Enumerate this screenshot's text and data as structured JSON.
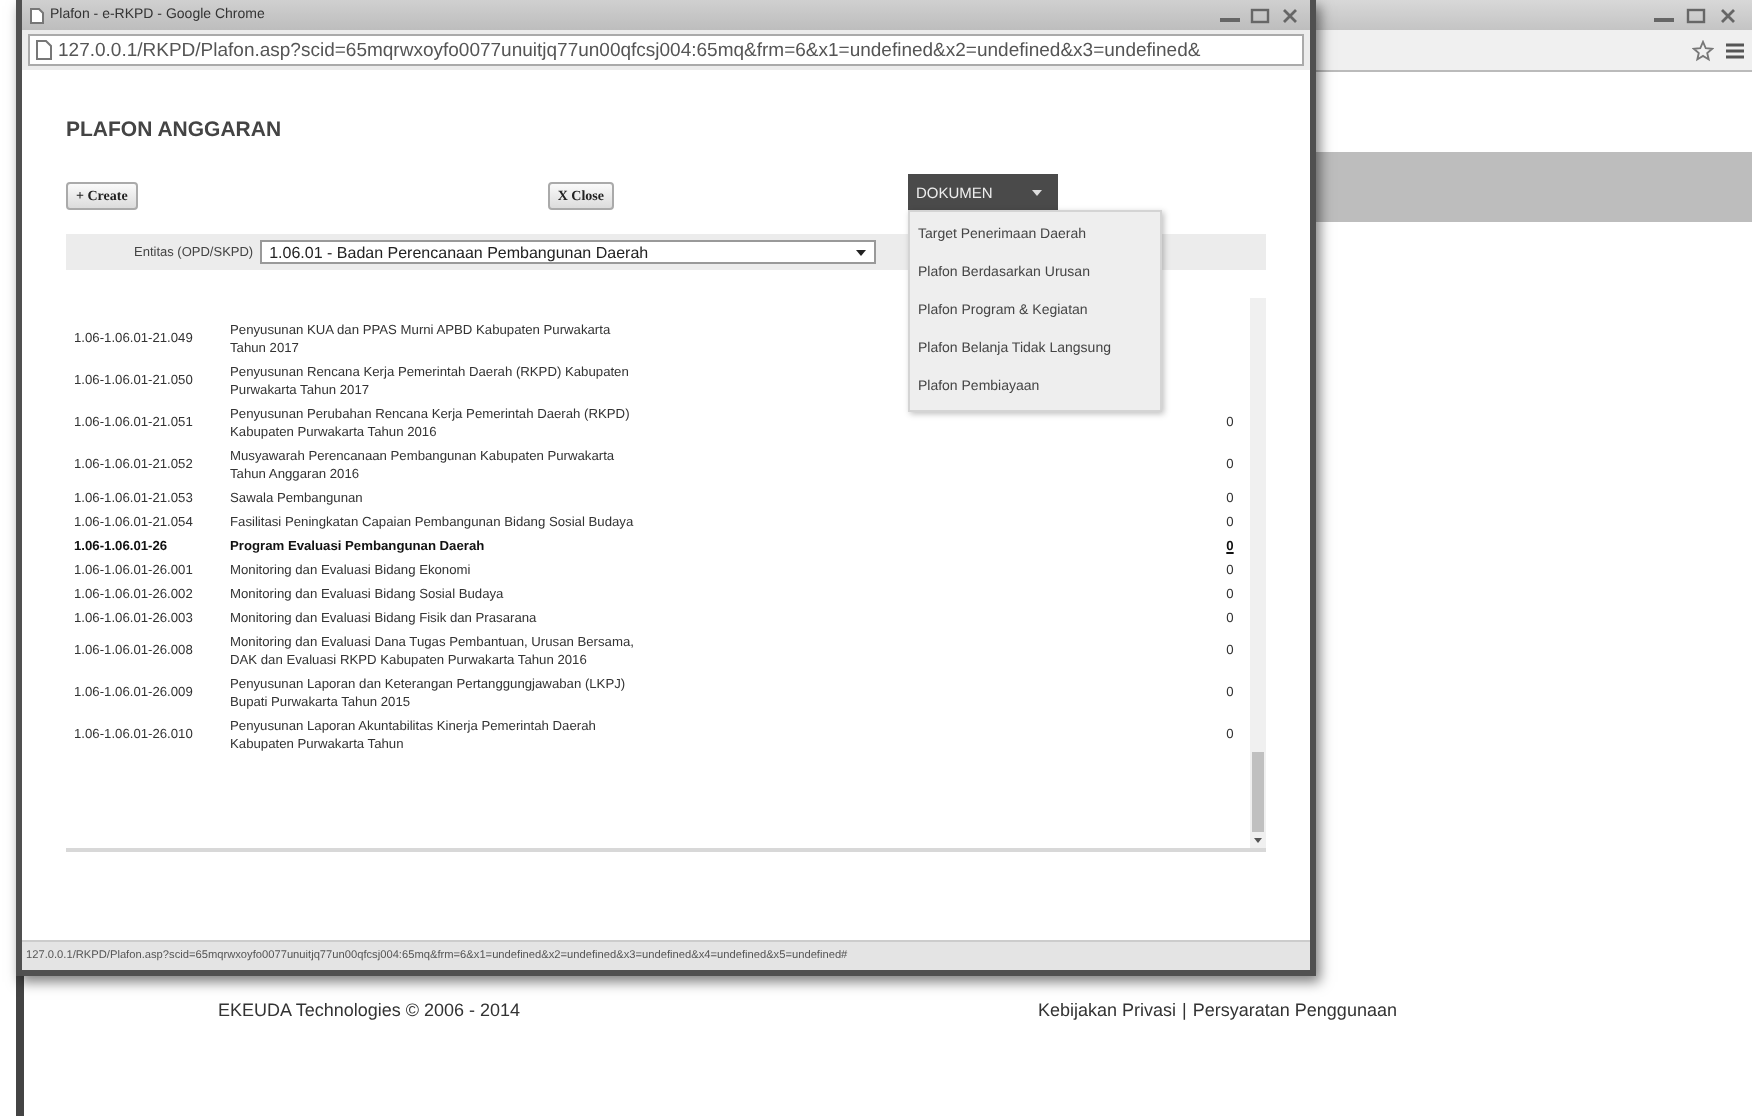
{
  "background_window": {
    "footer": {
      "copyright": "EKEUDA Technologies © 2006 - 2014",
      "links": [
        "Kebijakan Privasi",
        "Persyaratan Penggunaan"
      ],
      "separator": "|"
    }
  },
  "popup": {
    "title": "Plafon - e-RKPD - Google Chrome",
    "url": "127.0.0.1/RKPD/Plafon.asp?scid=65mqrwxoyfo0077unuitjq77un00qfcsj004:65mq&frm=6&x1=undefined&x2=undefined&x3=undefined&",
    "heading": "PLAFON ANGGARAN",
    "create_button": "+ Create",
    "close_button": "X Close",
    "dokumen": {
      "label": "DOKUMEN",
      "expanded": true,
      "items": [
        "Target Penerimaan Daerah",
        "Plafon Berdasarkan Urusan",
        "Plafon Program & Kegiatan",
        "Plafon Belanja Tidak Langsung",
        "Plafon Pembiayaan"
      ]
    },
    "entitas": {
      "label": "Entitas (OPD/SKPD)",
      "value": "1.06.01 - Badan Perencanaan Pembangunan Daerah"
    },
    "rows": [
      {
        "kind": "kegiatan",
        "code": "1.06-1.06.01-21.049",
        "name": "Penyusunan KUA dan PPAS Murni APBD Kabupaten Purwakarta Tahun 2017"
      },
      {
        "kind": "kegiatan",
        "code": "1.06-1.06.01-21.050",
        "name": "Penyusunan Rencana Kerja Pemerintah Daerah (RKPD) Kabupaten Purwakarta Tahun 2017"
      },
      {
        "kind": "kegiatan",
        "code": "1.06-1.06.01-21.051",
        "name": "Penyusunan Perubahan Rencana Kerja Pemerintah Daerah (RKPD) Kabupaten Purwakarta Tahun 2016",
        "value": "0"
      },
      {
        "kind": "kegiatan",
        "code": "1.06-1.06.01-21.052",
        "name": "Musyawarah Perencanaan Pembangunan Kabupaten Purwakarta Tahun Anggaran 2016",
        "value": "0"
      },
      {
        "kind": "kegiatan",
        "code": "1.06-1.06.01-21.053",
        "name": "Sawala Pembangunan",
        "value": "0"
      },
      {
        "kind": "kegiatan",
        "code": "1.06-1.06.01-21.054",
        "name": "Fasilitasi Peningkatan Capaian Pembangunan Bidang Sosial Budaya",
        "value": "0"
      },
      {
        "kind": "program",
        "code": "1.06-1.06.01-26",
        "name": "Program Evaluasi Pembangunan Daerah",
        "value": "0"
      },
      {
        "kind": "kegiatan",
        "code": "1.06-1.06.01-26.001",
        "name": "Monitoring dan Evaluasi Bidang Ekonomi",
        "value": "0"
      },
      {
        "kind": "kegiatan",
        "code": "1.06-1.06.01-26.002",
        "name": "Monitoring dan Evaluasi Bidang Sosial Budaya",
        "value": "0"
      },
      {
        "kind": "kegiatan",
        "code": "1.06-1.06.01-26.003",
        "name": "Monitoring dan Evaluasi Bidang Fisik dan Prasarana",
        "value": "0"
      },
      {
        "kind": "kegiatan",
        "code": "1.06-1.06.01-26.008",
        "name": "Monitoring dan Evaluasi Dana Tugas Pembantuan, Urusan Bersama, DAK dan Evaluasi RKPD Kabupaten Purwakarta Tahun 2016",
        "value": "0"
      },
      {
        "kind": "kegiatan",
        "code": "1.06-1.06.01-26.009",
        "name": "Penyusunan Laporan dan Keterangan Pertanggungjawaban (LKPJ) Bupati Purwakarta Tahun 2015",
        "value": "0"
      },
      {
        "kind": "kegiatan",
        "code": "1.06-1.06.01-26.010",
        "name": "Penyusunan Laporan Akuntabilitas Kinerja Pemerintah Daerah Kabupaten Purwakarta Tahun",
        "value": "0"
      }
    ],
    "status_url": "127.0.0.1/RKPD/Plafon.asp?scid=65mqrwxoyfo0077unuitjq77un00qfcsj004:65mq&frm=6&x1=undefined&x2=undefined&x3=undefined&x4=undefined&x5=undefined#"
  }
}
